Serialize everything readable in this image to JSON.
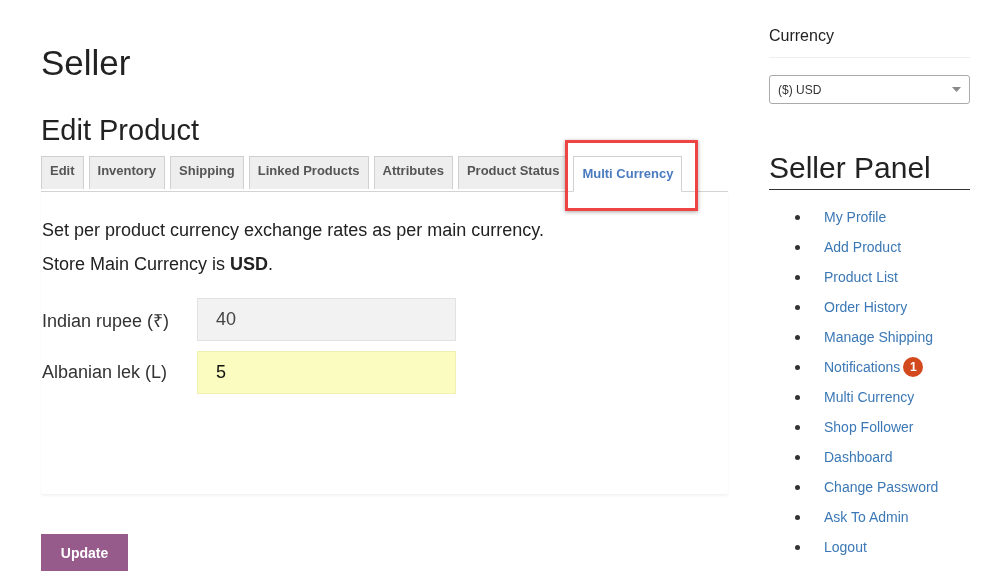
{
  "page_title": "Seller",
  "section_title": "Edit Product",
  "tabs": [
    {
      "label": "Edit",
      "selected": false,
      "highlighted": false
    },
    {
      "label": "Inventory",
      "selected": false,
      "highlighted": false
    },
    {
      "label": "Shipping",
      "selected": false,
      "highlighted": false
    },
    {
      "label": "Linked Products",
      "selected": false,
      "highlighted": false
    },
    {
      "label": "Attributes",
      "selected": false,
      "highlighted": false
    },
    {
      "label": "Product Status",
      "selected": false,
      "highlighted": false
    },
    {
      "label": "Multi Currency",
      "selected": true,
      "highlighted": true
    }
  ],
  "intro": [
    "Set per product currency exchange rates as per main currency.",
    "Store Main Currency is **USD**."
  ],
  "rates": [
    {
      "label": "Indian rupee (₹)",
      "value": "40",
      "focused": false
    },
    {
      "label": "Albanian lek (L)",
      "value": "5",
      "focused": true
    }
  ],
  "update_button": "Update",
  "sidebar": {
    "currency_title": "Currency",
    "currency_select": "($) USD",
    "panel_title": "Seller Panel",
    "items": [
      {
        "label": "My Profile"
      },
      {
        "label": "Add Product"
      },
      {
        "label": "Product List"
      },
      {
        "label": "Order History"
      },
      {
        "label": "Manage Shipping"
      },
      {
        "label": "Notifications",
        "badge": "1"
      },
      {
        "label": "Multi Currency"
      },
      {
        "label": "Shop Follower"
      },
      {
        "label": "Dashboard"
      },
      {
        "label": "Change Password"
      },
      {
        "label": "Ask To Admin"
      },
      {
        "label": "Logout"
      }
    ]
  }
}
